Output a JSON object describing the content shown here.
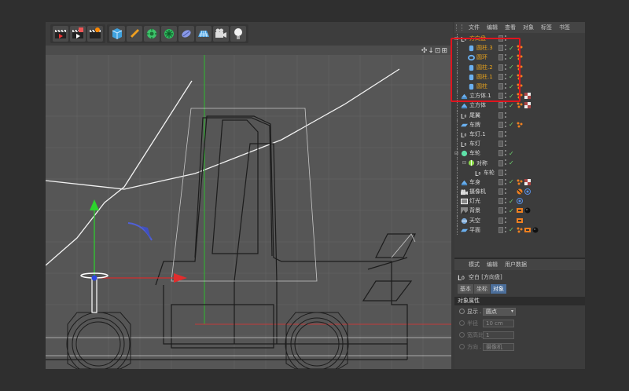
{
  "menu": [
    "文件",
    "编辑",
    "查看",
    "对象",
    "标签",
    "书签"
  ],
  "tree": [
    {
      "name": "方向盘",
      "level": 0,
      "icon": "null-object-icon",
      "selected": true,
      "has_check": false
    },
    {
      "name": "圆柱.3",
      "level": 1,
      "icon": "cylinder-icon",
      "selected": true,
      "has_check": true
    },
    {
      "name": "圆环",
      "level": 1,
      "icon": "torus-icon",
      "selected": true,
      "has_check": true
    },
    {
      "name": "圆柱.2",
      "level": 1,
      "icon": "cylinder-icon",
      "selected": true,
      "has_check": true
    },
    {
      "name": "圆柱.1",
      "level": 1,
      "icon": "cylinder-icon",
      "selected": true,
      "has_check": true
    },
    {
      "name": "圆柱",
      "level": 1,
      "icon": "cylinder-icon",
      "selected": true,
      "has_check": true
    },
    {
      "name": "立方体.1",
      "level": 0,
      "icon": "cube-icon",
      "selected": false,
      "has_check": true
    },
    {
      "name": "立方体",
      "level": 0,
      "icon": "cube-icon",
      "selected": false,
      "has_check": true
    },
    {
      "name": "尾翼",
      "level": 0,
      "icon": "null-object-icon",
      "selected": false,
      "has_check": false
    },
    {
      "name": "车牌",
      "level": 0,
      "icon": "plane-icon",
      "selected": false,
      "has_check": true
    },
    {
      "name": "车灯.1",
      "level": 0,
      "icon": "null-object-icon",
      "selected": false,
      "has_check": false
    },
    {
      "name": "车灯",
      "level": 0,
      "icon": "null-object-icon",
      "selected": false,
      "has_check": false
    },
    {
      "name": "车轮",
      "level": 0,
      "icon": "sphere-icon",
      "selected": false,
      "has_check": true
    },
    {
      "name": "对称",
      "level": 1,
      "icon": "symmetry-icon",
      "selected": false,
      "has_check": true
    },
    {
      "name": "车轮",
      "level": 2,
      "icon": "null-object-icon",
      "selected": false,
      "has_check": false
    },
    {
      "name": "车身",
      "level": 0,
      "icon": "cube-icon",
      "selected": false,
      "has_check": true
    },
    {
      "name": "摄像机",
      "level": 0,
      "icon": "camera-icon",
      "selected": false,
      "has_check": false
    },
    {
      "name": "灯光",
      "level": 0,
      "icon": "light-icon",
      "selected": false,
      "has_check": true
    },
    {
      "name": "背景",
      "level": 0,
      "icon": "background-icon",
      "selected": false,
      "has_check": true
    },
    {
      "name": "天空",
      "level": 0,
      "icon": "sky-icon",
      "selected": false,
      "has_check": false
    },
    {
      "name": "平面",
      "level": 0,
      "icon": "plane-icon",
      "selected": false,
      "has_check": true
    }
  ],
  "attributes": {
    "menu": [
      "模式",
      "编辑",
      "用户数据"
    ],
    "title": "空白 [方向盘]",
    "tabs": [
      "基本",
      "坐标",
      "对象"
    ],
    "active_tab": "对象",
    "section": "对象属性",
    "fields": [
      {
        "label": "显示",
        "value": "圆点",
        "type": "dropdown",
        "enabled": true
      },
      {
        "label": "半径",
        "value": "10 cm",
        "type": "number",
        "enabled": false
      },
      {
        "label": "宽高比",
        "value": "1",
        "type": "number",
        "enabled": false
      },
      {
        "label": "方向",
        "value": "摄像机",
        "type": "dropdown",
        "enabled": false
      }
    ]
  },
  "viewport": {
    "nav_icons": "✣↓⊡⊞"
  },
  "toolbar_icons": [
    "render-view-icon",
    "render-picture-viewer-icon",
    "render-settings-icon",
    "cube-icon",
    "pen-icon",
    "subdivision-icon",
    "array-icon",
    "deformer-icon",
    "floor-icon",
    "camera-icon",
    "light-icon"
  ],
  "colors": {
    "selection": "#e8a21c",
    "highlight_box": "#e0141e",
    "check": "#6fd16f",
    "active_tab": "#4b6e9a"
  }
}
